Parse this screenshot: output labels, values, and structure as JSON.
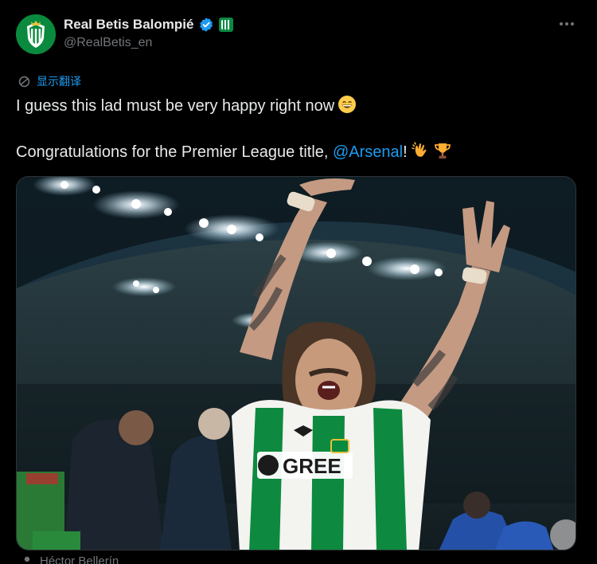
{
  "author": {
    "display_name": "Real Betis Balompié",
    "handle": "@RealBetis_en",
    "avatar_icon": "real-betis-crest-icon",
    "verified": true
  },
  "translate_label": "显示翻译",
  "tweet": {
    "line1": "I guess this lad must be very happy right now",
    "line2_prefix": "Congratulations for the Premier League title, ",
    "mention": "@Arsenal",
    "line2_suffix": "!",
    "emojis": [
      "grinning-face-icon",
      "clapping-hands-icon",
      "trophy-icon"
    ]
  },
  "media": {
    "jersey_sponsor": "GREE",
    "photo_subject": "player-celebrating-photo"
  },
  "tagged_person": "Héctor Bellerín",
  "colors": {
    "accent": "#1d9bf0",
    "betis_green": "#0a8a3e",
    "text": "#e7e9ea",
    "muted": "#71767b"
  }
}
